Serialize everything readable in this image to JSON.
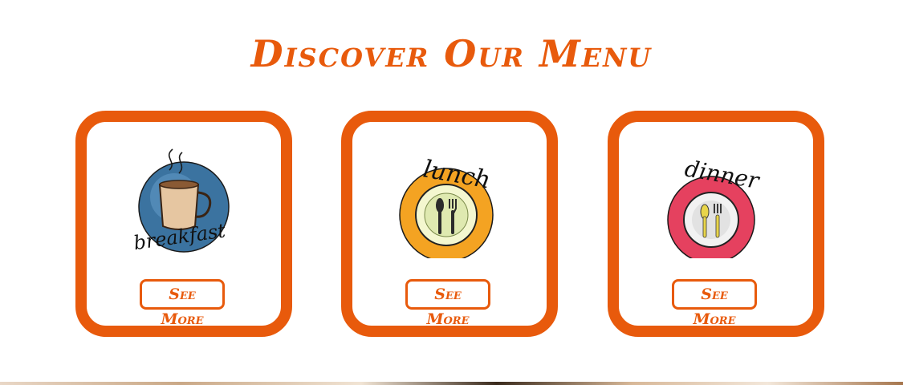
{
  "page": {
    "title": "Discover Our Menu",
    "accent_color": "#e85a0c"
  },
  "cards": [
    {
      "image_text": "breakfast",
      "image_icon": "coffee-cup-icon",
      "button_label": "See More"
    },
    {
      "image_text": "lunch",
      "image_icon": "plate-with-utensils-icon",
      "button_label": "See More"
    },
    {
      "image_text": "dinner",
      "image_icon": "plate-with-utensils-icon",
      "button_label": "See More"
    }
  ]
}
